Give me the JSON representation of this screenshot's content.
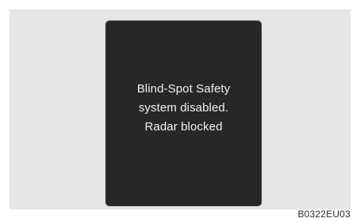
{
  "display": {
    "message_lines": [
      "Blind-Spot Safety",
      "system disabled.",
      "Radar blocked"
    ]
  },
  "figure_code": "B0322EU03",
  "colors": {
    "panel_background": "#e6e6e6",
    "screen_background": "#272727",
    "message_text": "#f2f2f2"
  }
}
